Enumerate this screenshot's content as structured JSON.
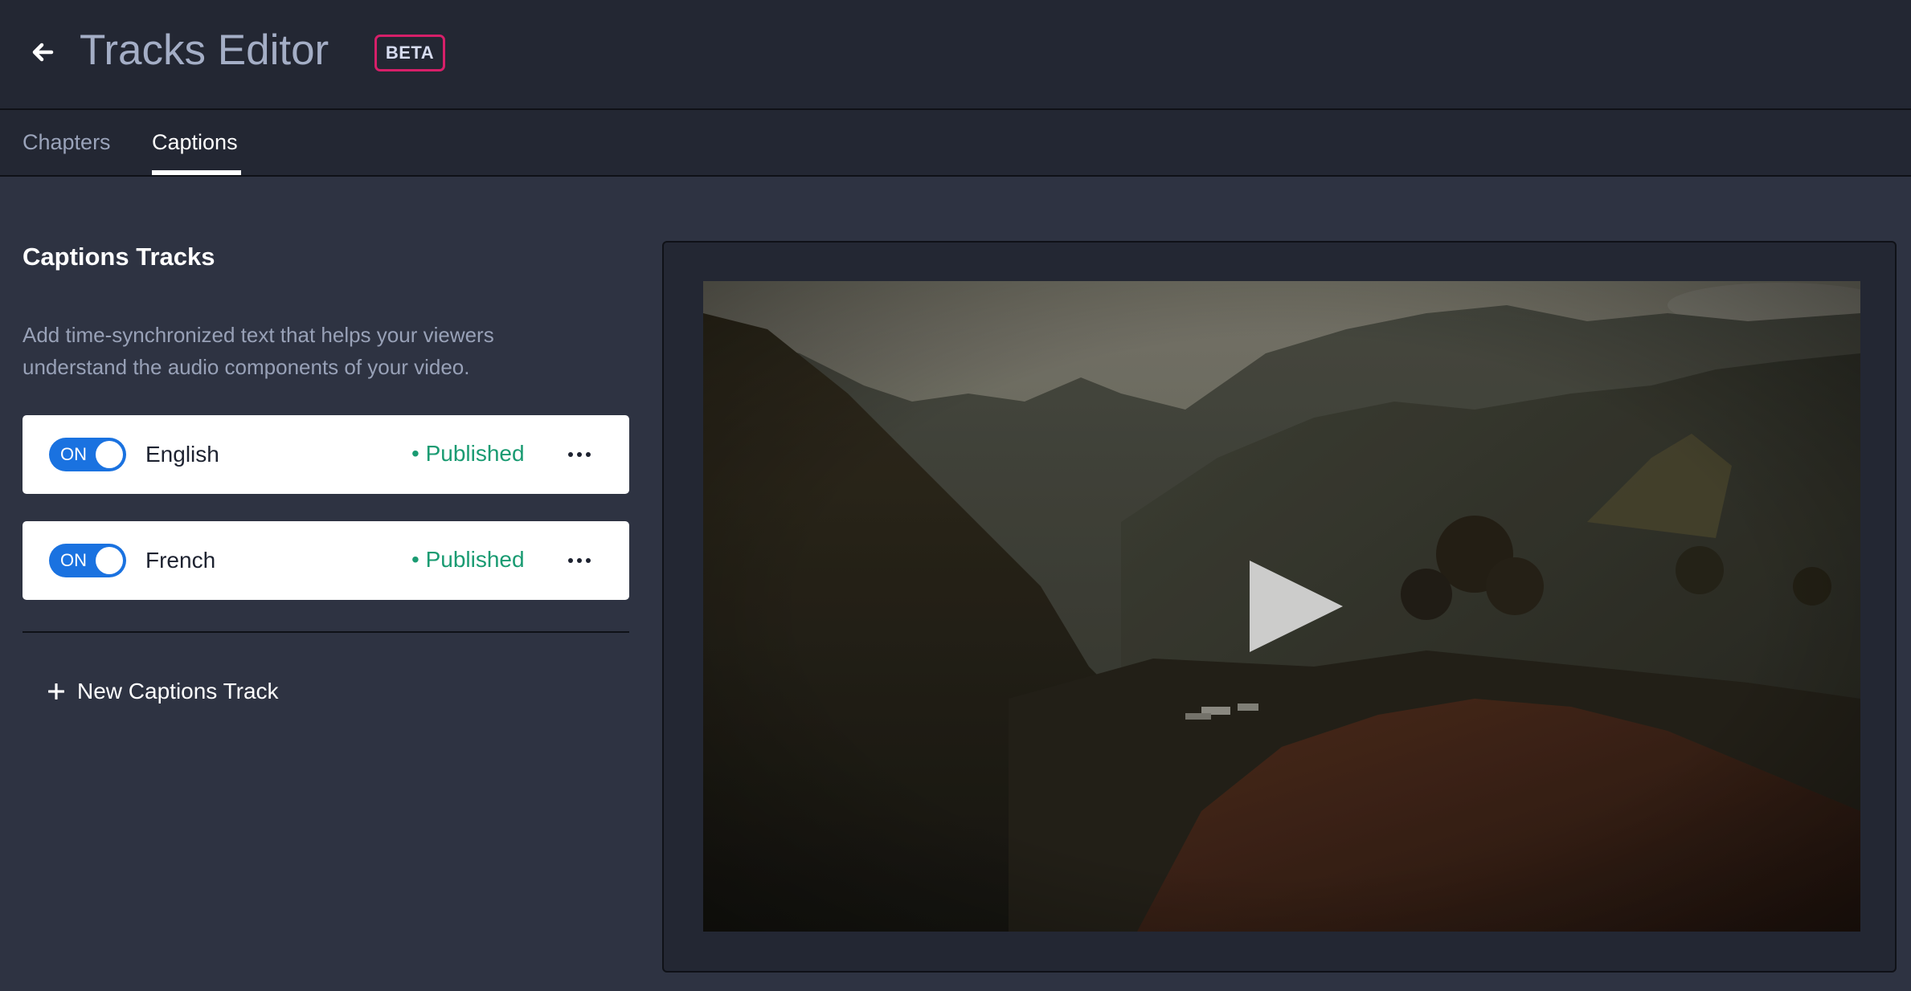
{
  "header": {
    "title": "Tracks Editor",
    "badge": "BETA"
  },
  "tabs": [
    {
      "label": "Chapters",
      "active": false
    },
    {
      "label": "Captions",
      "active": true
    }
  ],
  "captions": {
    "title": "Captions Tracks",
    "description": "Add time-synchronized text that helps your viewers understand the audio components of your video.",
    "tracks": [
      {
        "toggle": "ON",
        "enabled": true,
        "language": "English",
        "status": "• Published"
      },
      {
        "toggle": "ON",
        "enabled": true,
        "language": "French",
        "status": "• Published"
      }
    ],
    "new_track_label": "New Captions Track"
  },
  "colors": {
    "header_bg": "#232733",
    "page_bg": "#2e3342",
    "badge_border": "#d61f69",
    "toggle_on": "#1a72e0",
    "published": "#1a9b72"
  },
  "icons": {
    "back": "arrow-left-icon",
    "more": "more-horizontal-icon",
    "add": "plus-icon",
    "play": "play-icon"
  }
}
